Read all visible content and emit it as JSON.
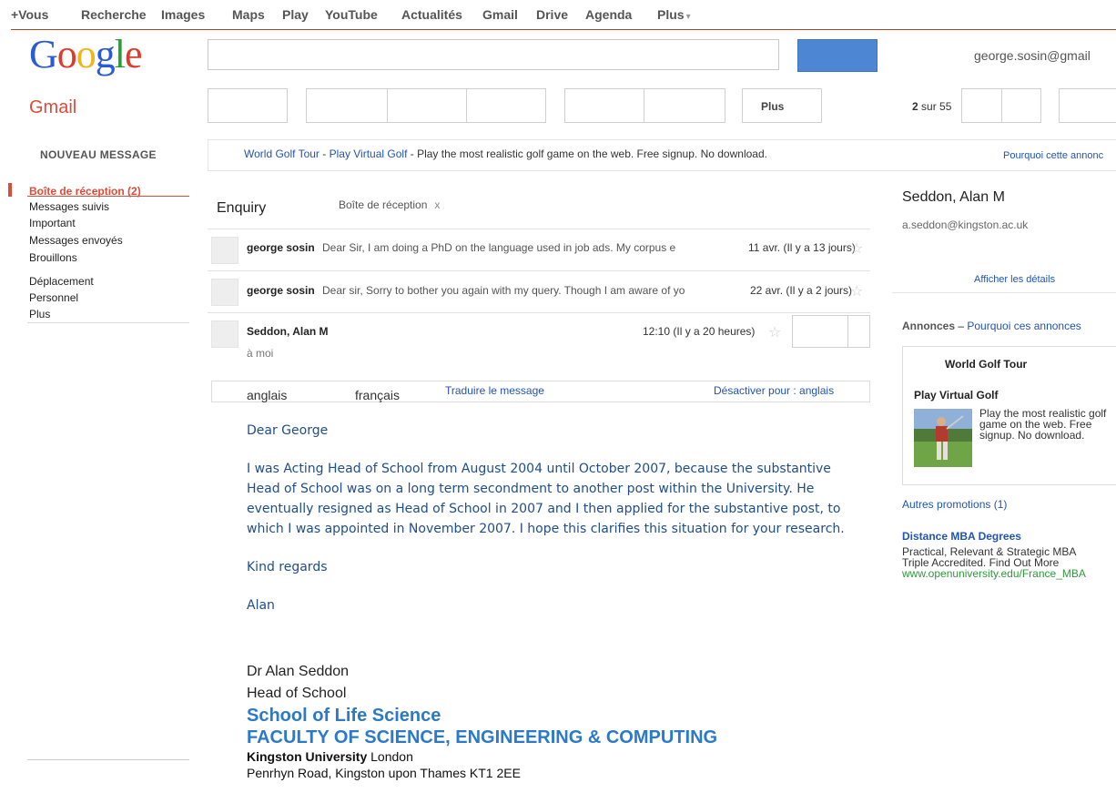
{
  "topbar": {
    "items": [
      "+Vous",
      "Recherche",
      "Images",
      "Maps",
      "Play",
      "YouTube",
      "Actualités",
      "Gmail",
      "Drive",
      "Agenda",
      "Plus"
    ],
    "more_caret": "▾"
  },
  "header": {
    "logo": [
      "G",
      "o",
      "o",
      "g",
      "l",
      "e"
    ],
    "account_email": "george.sosin@gmail",
    "app_name": "Gmail"
  },
  "toolbar": {
    "more_label": "Plus",
    "page_current": "2",
    "page_rest": " sur 55"
  },
  "sidebar": {
    "compose_label": "NOUVEAU MESSAGE",
    "items": [
      {
        "label": "Boîte de réception (2)",
        "active": true
      },
      {
        "label": "Messages suivis"
      },
      {
        "label": "Important"
      },
      {
        "label": "Messages envoyés"
      },
      {
        "label": "Brouillons"
      },
      {
        "label": "Déplacement"
      },
      {
        "label": "Personnel"
      },
      {
        "label": "Plus"
      }
    ]
  },
  "adbar": {
    "link1": "World Golf Tour",
    "sep1": " - ",
    "link2": "Play Virtual Golf",
    "text": " - Play the most realistic golf game on the web. Free signup. No download.",
    "why": "Pourquoi cette annonc"
  },
  "thread": {
    "subject": "Enquiry",
    "label": "Boîte de réception",
    "label_remove": "x",
    "messages": [
      {
        "sender": "george sosin",
        "snippet": "Dear Sir, I am doing a PhD on the language used in job ads. My corpus e",
        "date": "11 avr. (Il y a 13 jours)"
      },
      {
        "sender": "george sosin",
        "snippet": "Dear sir, Sorry to bother you again with my query. Though I am aware of yo",
        "date": "22 avr. (Il y a 2 jours)"
      }
    ],
    "open_message": {
      "sender": "Seddon, Alan M",
      "date": "12:10 (Il y a 20 heures)",
      "to": "à moi"
    }
  },
  "translate": {
    "lang_from": "anglais",
    "lang_to": "français",
    "translate_link": "Traduire le message",
    "disable_link": "Désactiver pour : anglais"
  },
  "body": {
    "greeting": "Dear George",
    "paragraph": "I was Acting Head of School from August 2004 until October 2007, because the substantive Head of School was on a long term secondment to another post within the University. He eventually resigned as Head of School in 2007 and I then applied for the substantive post, to which I was appointed in November 2007. I hope this clarifies this situation for your research.",
    "closing": "Kind regards",
    "name": "Alan"
  },
  "signature": {
    "name": "Dr Alan Seddon",
    "title": "Head of School",
    "school": "School of Life Science",
    "faculty": "FACULTY OF SCIENCE, ENGINEERING & COMPUTING",
    "university_bold": "Kingston University",
    "university_rest": " London",
    "address": "Penrhyn Road, Kingston upon Thames KT1 2EE"
  },
  "contact": {
    "name": "Seddon, Alan M",
    "email": "a.seddon@kingston.ac.uk",
    "details_link": "Afficher les détails"
  },
  "ads": {
    "heading": "Annonces",
    "heading_sep": " – ",
    "heading_link": "Pourquoi ces annonces",
    "box": {
      "title": "World Golf Tour",
      "subtitle": "Play Virtual Golf",
      "description": "Play the most realistic golf game on the web. Free signup. No download."
    },
    "more_promos": "Autres promotions (1)",
    "ad2": {
      "title": "Distance MBA Degrees",
      "line1": "Practical, Relevant & Strategic MBA",
      "line2": "Triple Accredited. Find Out More",
      "url": "www.openuniversity.edu/France_MBA"
    }
  },
  "colors": {
    "accent_red": "#dd4b39",
    "link_blue": "#2254b5",
    "signature_blue": "#2b7ac9",
    "search_blue": "#4d86d2",
    "url_green": "#2e9a3d"
  }
}
